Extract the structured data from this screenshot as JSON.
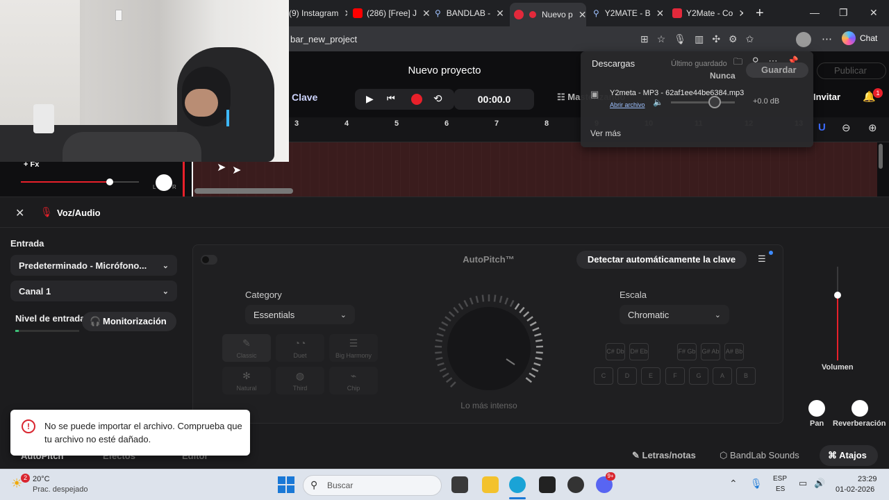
{
  "browser": {
    "tabs": [
      {
        "label": "(9) Instagram",
        "color": "#d62976"
      },
      {
        "label": "(286) [Free] J",
        "color": "#ff0000"
      },
      {
        "label": "BANDLAB - ",
        "color": "#3c8ce7"
      },
      {
        "label": "Nuevo p",
        "color": "#e3293b"
      },
      {
        "label": "Y2MATE - B",
        "color": "#3c8ce7"
      },
      {
        "label": "Y2Mate - Co",
        "color": "#e3293b"
      }
    ],
    "new_tab": "+",
    "url": "bar_new_project",
    "chat_label": "Chat",
    "window_controls": {
      "minimize": "—",
      "maximize": "❐",
      "close": "✕"
    }
  },
  "downloads": {
    "title": "Descargas",
    "file_name": "Y2meta - MP3 - 62af1ee44be6384.mp3",
    "open_file": "Abrir archivo",
    "see_more": "Ver más"
  },
  "header": {
    "project_title": "Nuevo proyecto",
    "last_saved_label": "Último guardado",
    "last_saved_value": "Nunca",
    "save_label": "Guardar",
    "publish_label": "Publicar",
    "key_label": "Clave",
    "time": "00:00.0",
    "mastering_label": "Masterizando",
    "volume_db": "+0.0 dB",
    "invite_label": "Invitar",
    "notif_count": "1"
  },
  "ruler": {
    "ticks": [
      "3",
      "4",
      "5",
      "6",
      "7",
      "8",
      "9",
      "10",
      "11",
      "12",
      "13"
    ]
  },
  "track": {
    "fx_label": "+ Fx",
    "pan_left": "L",
    "pan_right": "R",
    "volume_level": 0.75
  },
  "panel": {
    "title": "Voz/Audio",
    "input_label": "Entrada",
    "input_device": "Predeterminado - Micrófono...",
    "channel": "Canal 1",
    "input_level_label": "Nivel de entrada",
    "monitoring_label": "Monitorización",
    "autopitch": {
      "title": "AutoPitch™",
      "detect_key_label": "Detectar automáticamente la clave",
      "category_label": "Category",
      "category_value": "Essentials",
      "presets": [
        "Classic",
        "Duet",
        "Big Harmony",
        "Natural",
        "Third",
        "Chip"
      ],
      "scale_label": "Escala",
      "scale_value": "Chromatic",
      "sharps": [
        "C#\nDb",
        "D#\nEb",
        "F#\nGb",
        "G#\nAb",
        "A#\nBb"
      ],
      "naturals": [
        "C",
        "D",
        "E",
        "F",
        "G",
        "A",
        "B"
      ],
      "knob_label": "Lo más intenso"
    },
    "volume_label": "Volumen",
    "pan_label": "Pan",
    "reverb_label": "Reverberación",
    "bottom_tabs": [
      "AutoPitch",
      "Efectos",
      "Editor"
    ],
    "lyrics_label": "Letras/notas",
    "sounds_label": "BandLab Sounds",
    "shortcuts_label": "Atajos"
  },
  "toast": {
    "message": "No se puede importar el archivo. Comprueba que tu archivo no esté dañado."
  },
  "taskbar": {
    "weather_temp": "20°C",
    "weather_desc": "Prac. despejado",
    "weather_badge": "2",
    "search_placeholder": "Buscar",
    "lang_top": "ESP",
    "lang_bottom": "ES",
    "time": "23:29",
    "date": "01-02-2026",
    "discord_badge": "9+"
  }
}
